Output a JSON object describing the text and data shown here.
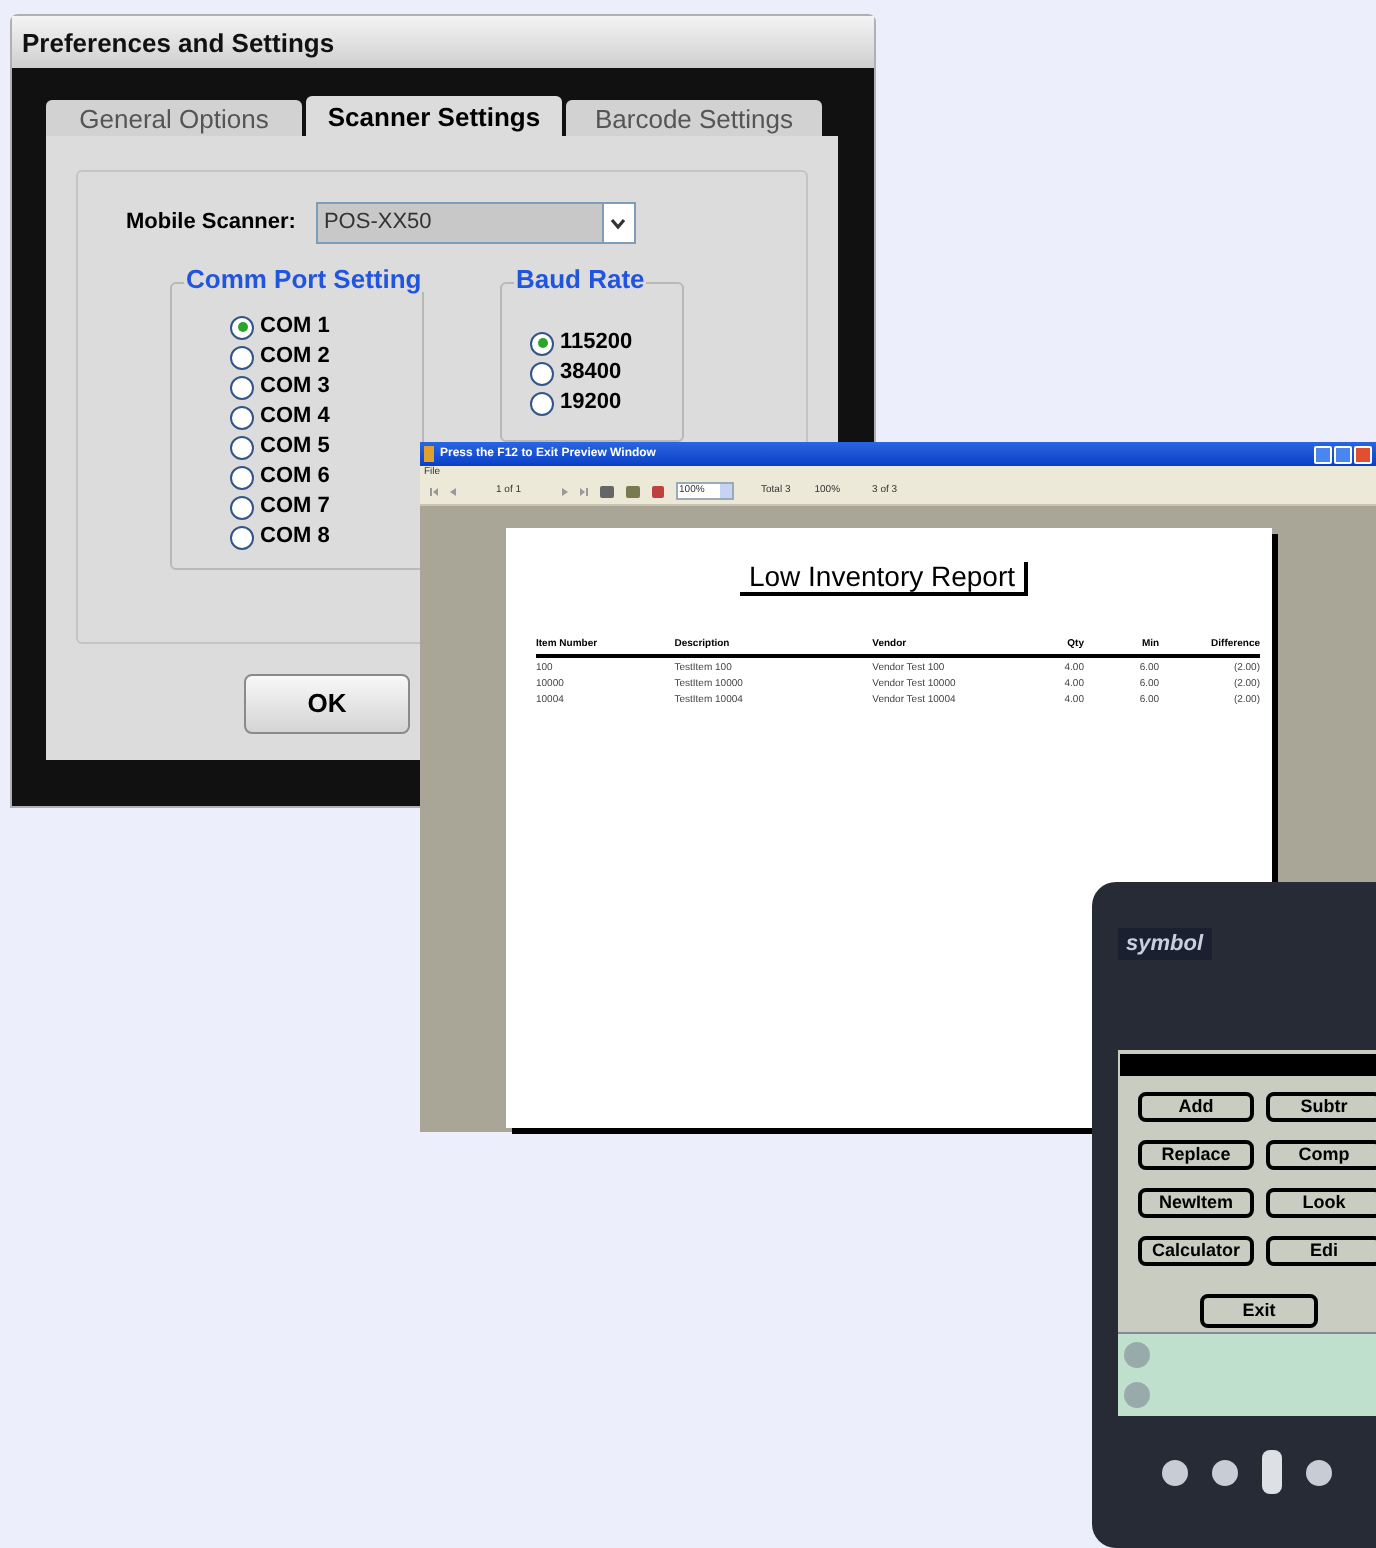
{
  "settings_window": {
    "title": "Preferences and Settings",
    "tabs": [
      {
        "label": "General Options",
        "selected": false
      },
      {
        "label": "Scanner Settings",
        "selected": true
      },
      {
        "label": "Barcode Settings",
        "selected": false
      }
    ],
    "mobile_scanner": {
      "label": "Mobile Scanner:",
      "value": "POS-XX50"
    },
    "comm_port": {
      "title": "Comm Port Setting",
      "options": [
        {
          "label": "COM 1",
          "selected": true
        },
        {
          "label": "COM 2",
          "selected": false
        },
        {
          "label": "COM 3",
          "selected": false
        },
        {
          "label": "COM 4",
          "selected": false
        },
        {
          "label": "COM 5",
          "selected": false
        },
        {
          "label": "COM 6",
          "selected": false
        },
        {
          "label": "COM 7",
          "selected": false
        },
        {
          "label": "COM 8",
          "selected": false
        }
      ]
    },
    "baud_rate": {
      "title": "Baud Rate",
      "options": [
        {
          "label": "115200",
          "selected": true
        },
        {
          "label": "38400",
          "selected": false
        },
        {
          "label": "19200",
          "selected": false
        }
      ]
    },
    "ok_button": "OK"
  },
  "preview_window": {
    "title": "Press the F12 to Exit Preview Window",
    "menu": [
      "File"
    ],
    "toolbar": {
      "page": "1 of 1",
      "zoom": "100%",
      "total": "Total 3",
      "percent": "100%",
      "count": "3 of 3"
    },
    "report": {
      "title": "Low Inventory Report",
      "columns": [
        "Item Number",
        "Description",
        "Vendor",
        "Qty",
        "Min",
        "Difference"
      ],
      "rows": [
        [
          "100",
          "TestItem 100",
          "Vendor Test 100",
          "4.00",
          "6.00",
          "(2.00)"
        ],
        [
          "10000",
          "TestItem 10000",
          "Vendor Test 10000",
          "4.00",
          "6.00",
          "(2.00)"
        ],
        [
          "10004",
          "TestItem 10004",
          "Vendor Test 10004",
          "4.00",
          "6.00",
          "(2.00)"
        ]
      ]
    }
  },
  "device": {
    "brand": "symbol",
    "buttons": [
      "Add",
      "Subtr",
      "Replace",
      "Comp",
      "NewItem",
      "Look",
      "Calculator",
      "Edi",
      "Exit"
    ]
  }
}
